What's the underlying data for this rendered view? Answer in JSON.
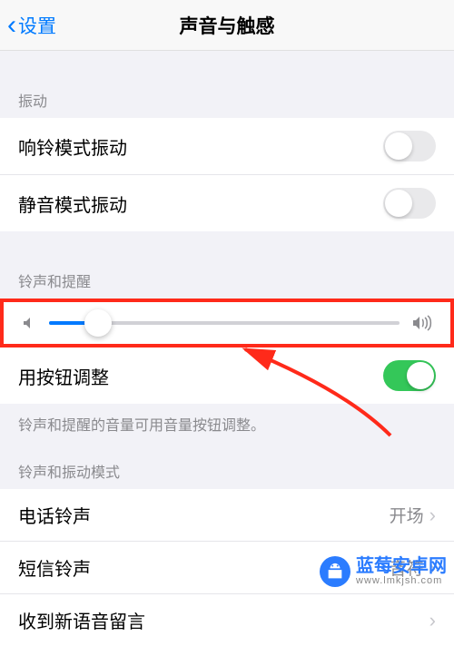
{
  "header": {
    "back_label": "设置",
    "title": "声音与触感"
  },
  "groups": {
    "vibration": {
      "header": "振动",
      "items": [
        {
          "label": "响铃模式振动",
          "on": false
        },
        {
          "label": "静音模式振动",
          "on": false
        }
      ]
    },
    "ringer": {
      "header": "铃声和提醒",
      "slider_value_pct": 14,
      "adjust_label": "用按钮调整",
      "adjust_on": true,
      "footer": "铃声和提醒的音量可用音量按钮调整。"
    },
    "patterns": {
      "header": "铃声和振动模式",
      "items": [
        {
          "label": "电话铃声",
          "value": "开场"
        },
        {
          "label": "短信铃声",
          "value": "音符"
        },
        {
          "label": "收到新语音留言",
          "value": ""
        }
      ]
    }
  },
  "watermark": {
    "brand": "蓝莓安卓网",
    "url": "www.lmkjsh.com"
  },
  "annotation": {
    "highlight_color": "#ff2a1a"
  },
  "icons": {
    "volume_low": "volume-low-icon",
    "volume_high": "volume-high-icon"
  }
}
